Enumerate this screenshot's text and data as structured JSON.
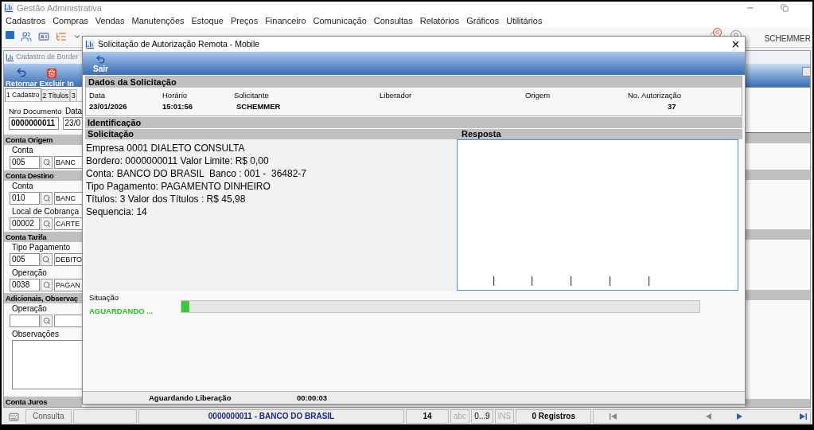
{
  "app": {
    "title": "Gestão Administrativa",
    "menu": [
      "Cadastros",
      "Compras",
      "Vendas",
      "Manutenções",
      "Estoque",
      "Preços",
      "Financeiro",
      "Comunicação",
      "Consultas",
      "Relatórios",
      "Gráficos",
      "Utilitários"
    ],
    "notification_count": "0",
    "user": "SCHEMMER"
  },
  "child_window": {
    "title": "Cadastro de Border",
    "toolbar": [
      {
        "label": "Retornar",
        "kind": "undo"
      },
      {
        "label": "Excluir",
        "kind": "delete"
      },
      {
        "label": "In",
        "kind": "plain"
      }
    ],
    "tabs": [
      {
        "label": "1 Cadastro",
        "selected": true
      },
      {
        "label": "2 Títulos",
        "selected": false
      },
      {
        "label": "3",
        "selected": false
      }
    ],
    "document": {
      "label": "Nro Documento",
      "value": "0000000011"
    },
    "date": {
      "label": "Data",
      "value": "23/0"
    },
    "sections": [
      {
        "title": "Conta Origem",
        "fields": [
          {
            "kind": "lookup",
            "label": "Conta",
            "code": "005",
            "description": "BANC"
          }
        ]
      },
      {
        "title": "Conta Destino",
        "fields": [
          {
            "kind": "lookup",
            "label": "Conta",
            "code": "010",
            "description": "BANC"
          },
          {
            "kind": "lookup",
            "label": "Local de Cobrança",
            "code": "00002",
            "description": "CARTE"
          }
        ]
      },
      {
        "title": "Conta Tarifa",
        "fields": [
          {
            "kind": "lookup",
            "label": "Tipo Pagamento",
            "code": "005",
            "description": "DEBITO"
          },
          {
            "kind": "lookup",
            "label": "Operação",
            "code": "0038",
            "description": "PAGAN"
          }
        ]
      },
      {
        "title": "Adicionais, Observaç",
        "fields": [
          {
            "kind": "lookup",
            "label": "Operação"
          },
          {
            "kind": "notes",
            "label": "Observações"
          }
        ]
      },
      {
        "title": "Conta Juros"
      }
    ]
  },
  "dialog": {
    "title": "Solicitação de Autorização Remota - Mobile",
    "toolbar": [
      {
        "label": "Sair"
      }
    ],
    "request_data": {
      "title": "Dados da Solicitação",
      "columns": [
        {
          "label": "Data",
          "value": "23/01/2026"
        },
        {
          "label": "Horário",
          "value": "15:01:56"
        },
        {
          "label": "Solicitante",
          "value": "SCHEMMER"
        },
        {
          "label": "Liberador"
        },
        {
          "label": "Origem"
        },
        {
          "label": "No. Autorização",
          "value": "37"
        }
      ]
    },
    "identification": "Identificação",
    "request": {
      "title": "Solicitação",
      "lines": [
        "Empresa 0001 DIALETO CONSULTA",
        "Bordero: 0000000011 Valor Limite: R$ 0,00",
        "Conta: BANCO DO BRASIL  Banco : 001 -  36482-7",
        "Tipo Pagamento: PAGAMENTO DINHEIRO",
        "Títulos: 3 Valor dos Títulos : R$ 45,98",
        "Sequencia: 14"
      ]
    },
    "response": {
      "title": "Resposta"
    },
    "situation": {
      "label": "Situação",
      "value": "AGUARDANDO ...",
      "level": 0.015
    },
    "status": [
      "Aguardando Liberação",
      "00:00:03"
    ]
  },
  "status_bar": {
    "mode": "Consulta",
    "record": "0000000011 - BANCO DO BRASIL",
    "number": "14",
    "indicators": [
      {
        "label": "abc",
        "on": false
      },
      {
        "label": "0...9",
        "on": true
      },
      {
        "label": "INS",
        "on": false
      }
    ],
    "count": "0 Registros"
  }
}
